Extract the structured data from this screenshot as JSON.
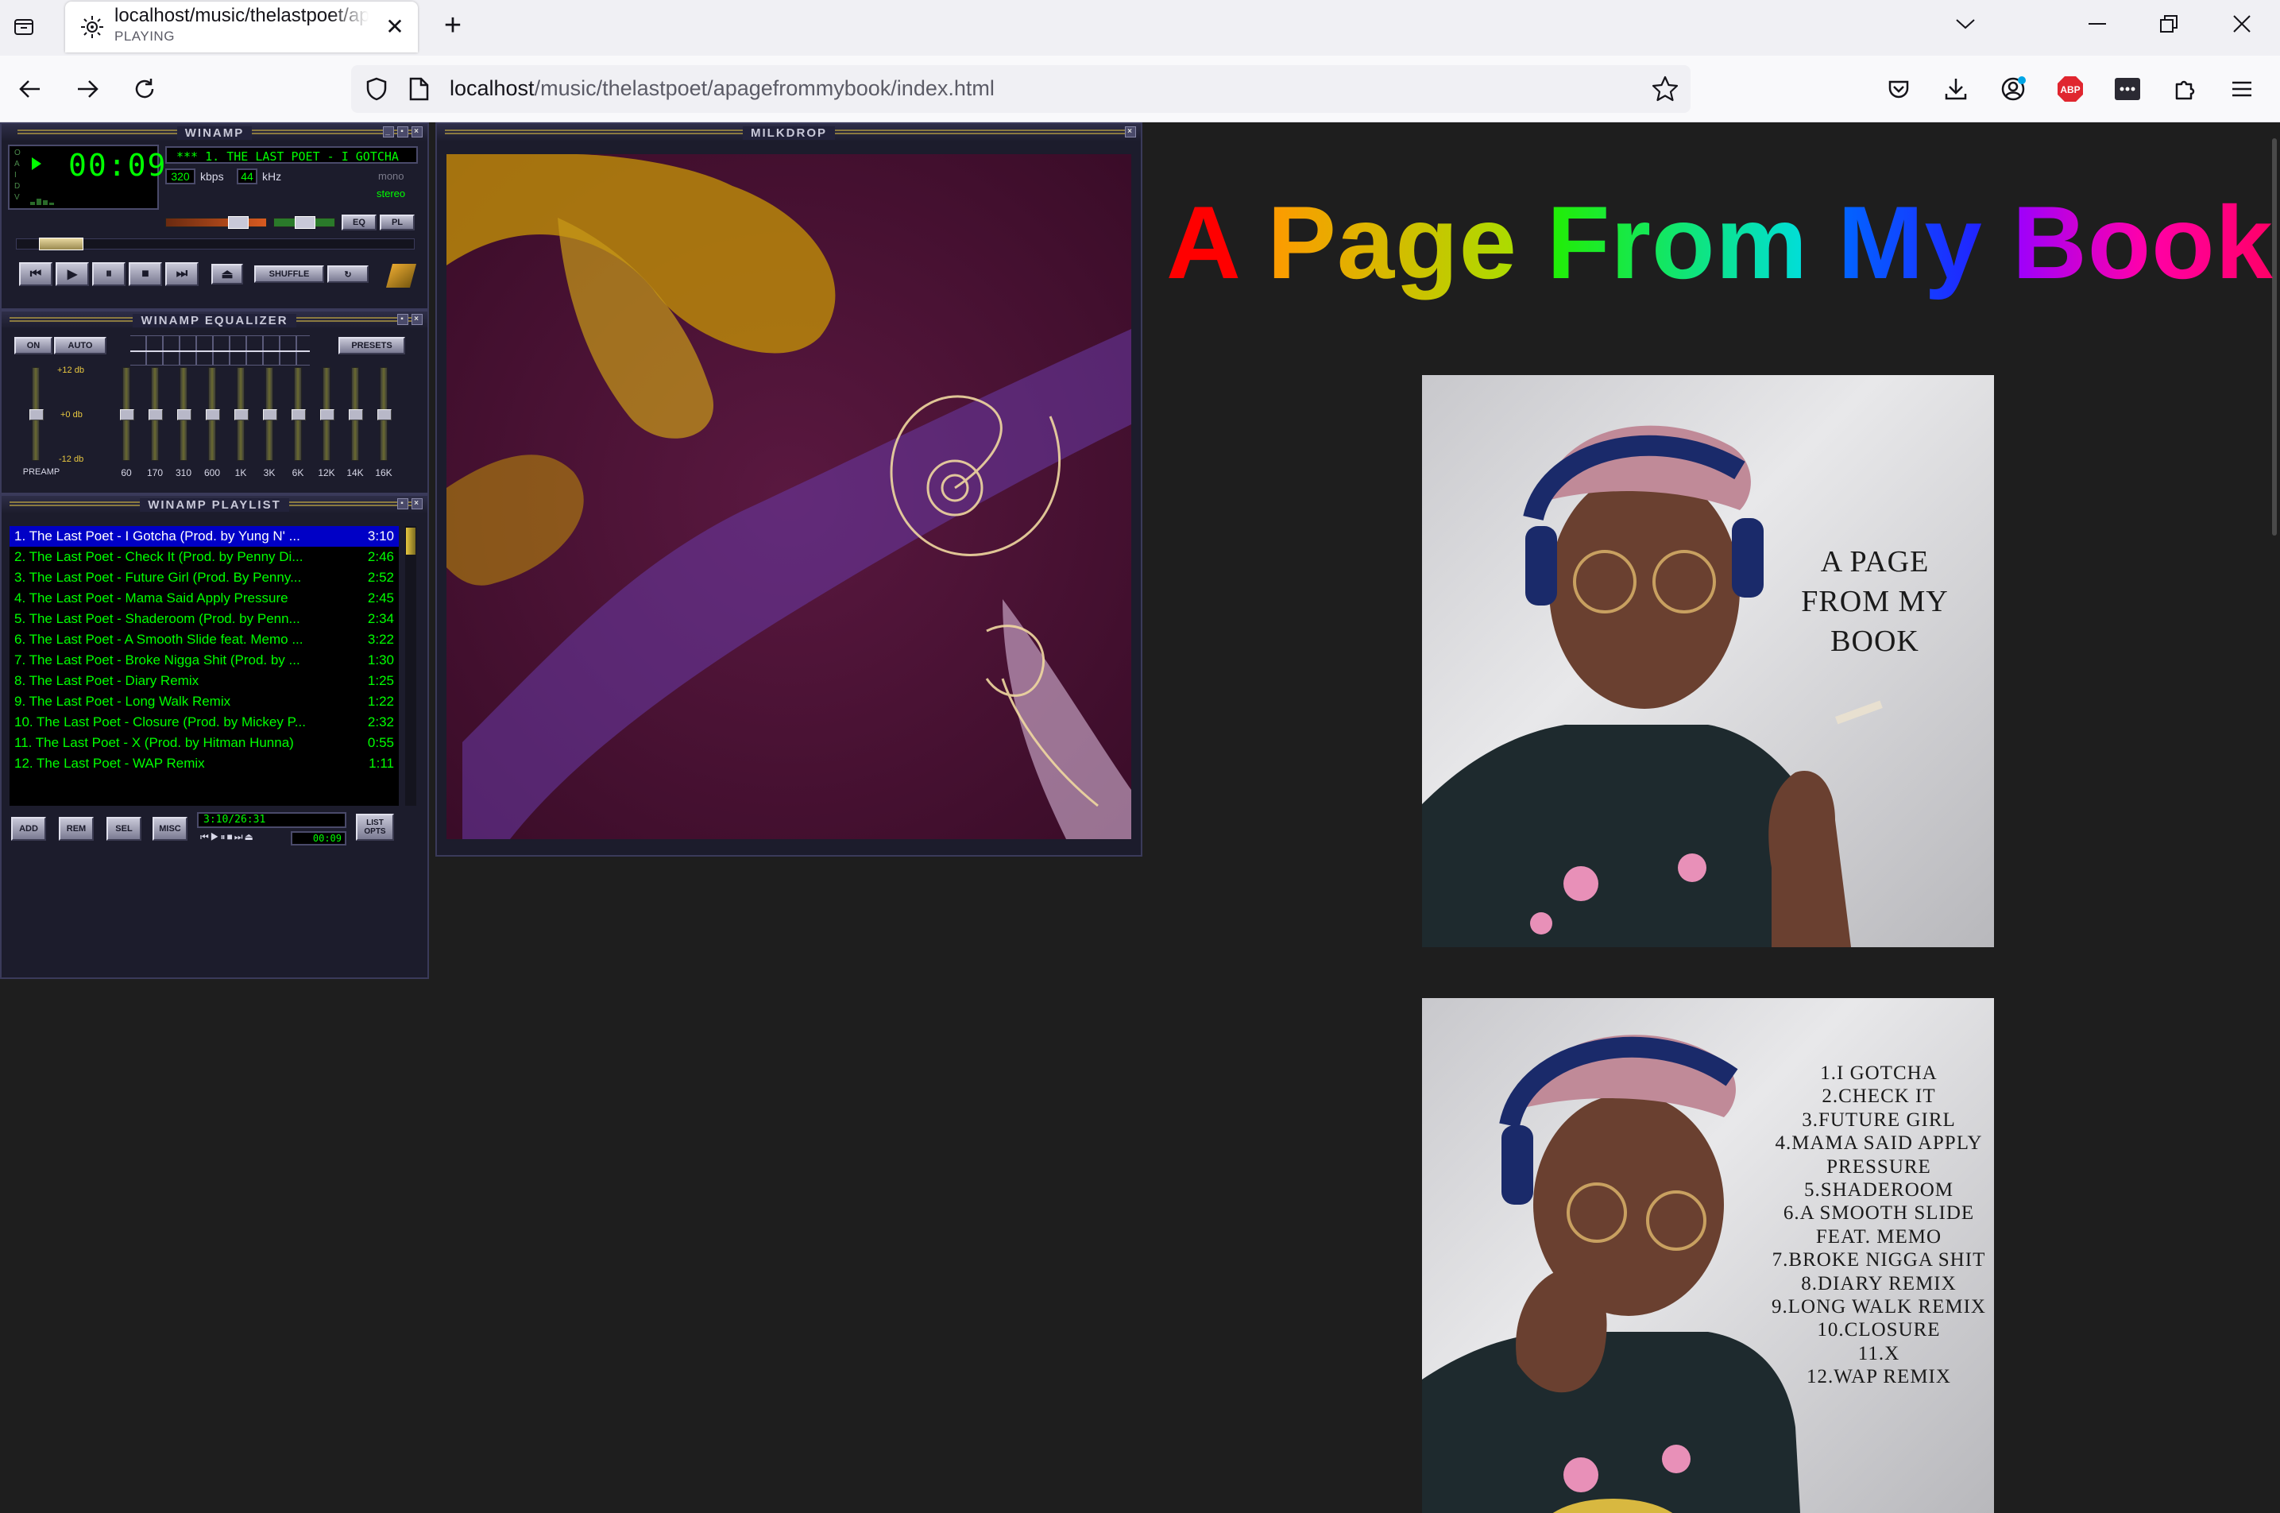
{
  "browser": {
    "tab": {
      "title": "localhost/music/thelastpoet/apagefrommybook/index.html",
      "status": "PLAYING"
    },
    "url": {
      "host": "localhost",
      "path": "/music/thelastpoet/apagefrommybook/index.html"
    },
    "toolbar": {
      "abp_label": "ABP"
    }
  },
  "winamp": {
    "main": {
      "title": "WINAMP",
      "time": "00:09",
      "marquee": "***  1. THE LAST POET - I GOTCHA",
      "kbps": "320",
      "kbps_label": "kbps",
      "khz": "44",
      "khz_label": "kHz",
      "mono": "mono",
      "stereo": "stereo",
      "eq_btn": "EQ",
      "pl_btn": "PL",
      "shuffle": "SHUFFLE",
      "status_letters": "OAIDV"
    },
    "equalizer": {
      "title": "WINAMP EQUALIZER",
      "on": "ON",
      "auto": "AUTO",
      "presets": "PRESETS",
      "db_top": "+12 db",
      "db_mid": "+0 db",
      "db_bot": "-12 db",
      "preamp": "PREAMP",
      "bands": [
        "60",
        "170",
        "310",
        "600",
        "1K",
        "3K",
        "6K",
        "12K",
        "14K",
        "16K"
      ]
    },
    "playlist": {
      "title": "WINAMP PLAYLIST",
      "tracks": [
        {
          "title": "1. The Last Poet - I Gotcha (Prod. by Yung N' ...",
          "dur": "3:10"
        },
        {
          "title": "2. The Last Poet - Check It (Prod. by Penny Di...",
          "dur": "2:46"
        },
        {
          "title": "3. The Last Poet - Future Girl (Prod. By Penny...",
          "dur": "2:52"
        },
        {
          "title": "4. The Last Poet - Mama Said Apply Pressure",
          "dur": "2:45"
        },
        {
          "title": "5. The Last Poet - Shaderoom (Prod. by Penn...",
          "dur": "2:34"
        },
        {
          "title": "6. The Last Poet - A Smooth Slide feat. Memo ...",
          "dur": "3:22"
        },
        {
          "title": "7. The Last Poet - Broke Nigga Shit (Prod. by ...",
          "dur": "1:30"
        },
        {
          "title": "8. The Last Poet - Diary Remix",
          "dur": "1:25"
        },
        {
          "title": "9. The Last Poet - Long Walk Remix",
          "dur": "1:22"
        },
        {
          "title": "10. The Last Poet - Closure (Prod. by Mickey P...",
          "dur": "2:32"
        },
        {
          "title": "11. The Last Poet - X (Prod. by Hitman Hunna)",
          "dur": "0:55"
        },
        {
          "title": "12. The Last Poet - WAP Remix",
          "dur": "1:11"
        }
      ],
      "add": "ADD",
      "rem": "REM",
      "sel": "SEL",
      "misc": "MISC",
      "total": "3:10/26:31",
      "mini_time": "00:09",
      "list_opts": "LIST OPTS"
    },
    "milkdrop": {
      "title": "MILKDROP"
    }
  },
  "page": {
    "heading_words": [
      "A",
      "Page",
      "From",
      "My",
      "Book"
    ],
    "cover_front_text": [
      "A PAGE",
      "FROM MY",
      "BOOK"
    ],
    "cover_back_tracks": [
      "1.I GOTCHA",
      "2.CHECK IT",
      "3.FUTURE GIRL",
      "4.MAMA SAID APPLY",
      "PRESSURE",
      "5.SHADEROOM",
      "6.A SMOOTH SLIDE",
      "FEAT. MEMO",
      "7.BROKE NIGGA SHIT",
      "8.DIARY REMIX",
      "9.LONG WALK REMIX",
      "10.CLOSURE",
      "11.X",
      "12.WAP REMIX"
    ]
  },
  "colors": {
    "lcd_green": "#00ff00",
    "playlist_sel": "#0000c6",
    "page_bg": "#1e1e1e"
  }
}
